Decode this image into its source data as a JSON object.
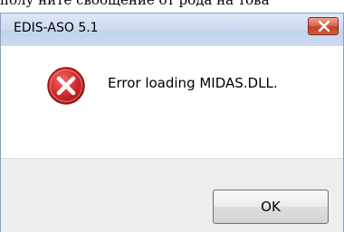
{
  "background_text": "полу ните своощение от рода на това",
  "dialog": {
    "title": "EDIS-ASO 5.1",
    "message": "Error loading MIDAS.DLL.",
    "ok_label": "OK"
  },
  "icons": {
    "error": "error-icon",
    "close": "close-icon"
  },
  "colors": {
    "error_red": "#c8262b",
    "close_button_red": "#c8412c",
    "titlebar": "#cfdcef",
    "footer": "#eeeeee"
  }
}
